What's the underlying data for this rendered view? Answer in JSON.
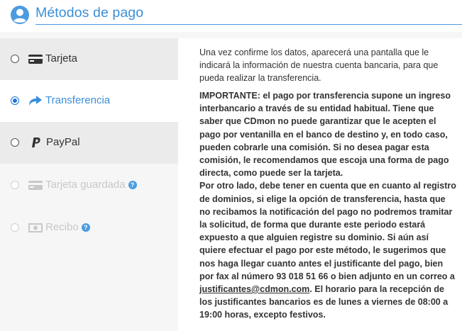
{
  "header": {
    "title": "Métodos de pago"
  },
  "options": {
    "tarjeta": "Tarjeta",
    "transferencia": "Transferencia",
    "paypal": "PayPal",
    "tarjeta_guardada": "Tarjeta guardada",
    "recibo": "Recibo",
    "selected": "Transferencia"
  },
  "panel": {
    "intro": "Una vez confirme los datos, aparecerá una pantalla que le indicará la información de nuestra cuenta bancaria, para que pueda realizar la transferencia.",
    "important_p1": "IMPORTANTE: el pago por transferencia supone un ingreso interbancario a través de su entidad habitual. Tiene que saber que CDmon no puede garantizar que le acepten el pago por ventanilla en el banco de destino y, en todo caso, pueden cobrarle una comisión. Si no desea pagar esta comisión, le recomendamos que escoja una forma de pago directa, como puede ser la tarjeta.",
    "important_p2_before": "Por otro lado, debe tener en cuenta que en cuanto al registro de dominios, si elige la opción de transferencia, hasta que no recibamos la notificación del pago no podremos tramitar la solicitud, de forma que durante este periodo estará expuesto a que alguien registre su dominio. Si aún así quiere efectuar el pago por este método, le sugerimos que nos haga llegar cuanto antes el justificante del pago, bien por fax al número 93 018 51 66 o bien adjunto en un correo a ",
    "email": "justificantes@cdmon.com",
    "important_p2_after": ". El horario para la recepción de los justificantes bancarios es de lunes a viernes de 08:00 a 19:00 horas, excepto festivos."
  },
  "colors": {
    "accent": "#3b8fd8",
    "radio": "#1a73d9",
    "disabled": "#c8c8c8"
  },
  "icons": {
    "header": "user-circle-icon",
    "tarjeta": "credit-card-icon",
    "transferencia": "share-arrow-icon",
    "paypal": "paypal-icon",
    "tarjeta_guardada": "credit-card-icon",
    "recibo": "money-bill-icon",
    "help": "question-circle-icon"
  }
}
